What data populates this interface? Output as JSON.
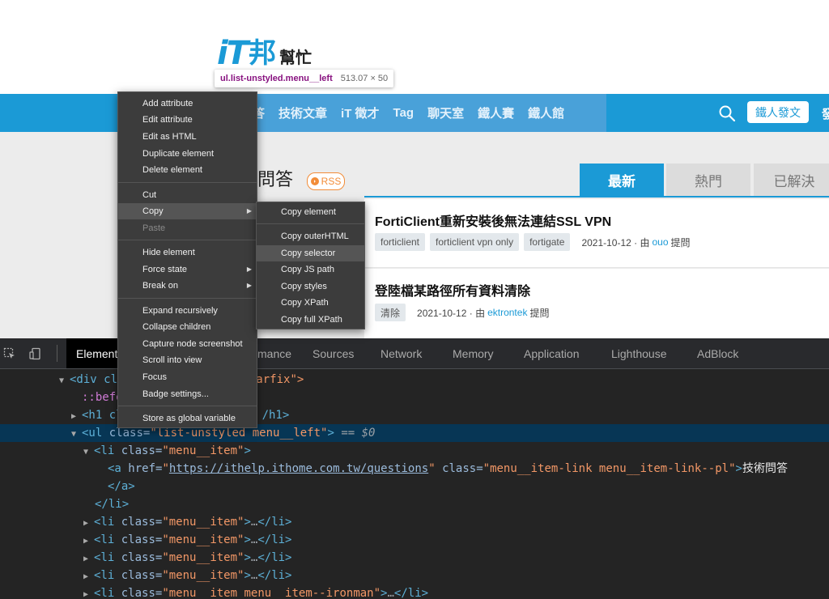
{
  "site": {
    "logo": {
      "it": "iT",
      "bang": "邦",
      "help": "幫忙"
    },
    "tooltip": {
      "selector": "ul.list-unstyled.menu__left",
      "dims": "513.07 × 50"
    },
    "nav": [
      "答",
      "技術文章",
      "iT 徵才",
      "Tag",
      "聊天室",
      "鐵人賽",
      "鐵人館"
    ],
    "ask_button": "鐵人發文",
    "nav_trail": "發",
    "section_title": "新問答",
    "rss": "RSS",
    "tabs": [
      "最新",
      "熱門",
      "已解決"
    ],
    "questions": [
      {
        "title": "FortiClient重新安裝後無法連結SSL VPN",
        "tags": [
          "forticlient",
          "forticlient vpn only",
          "fortigate"
        ],
        "date": "2021-10-12 · 由",
        "user": "ouo",
        "action": "提問"
      },
      {
        "title": "登陸檔某路徑所有資料清除",
        "tags": [
          "清除"
        ],
        "date": "2021-10-12 · 由",
        "user": "ektrontek",
        "action": "提問"
      }
    ]
  },
  "devtools": {
    "tabs": [
      "Elements",
      "mance",
      "Sources",
      "Network",
      "Memory",
      "Application",
      "Lighthouse",
      "AdBlock"
    ],
    "code": {
      "l1_open": "<div cl",
      "l1_rest": "clearfix\">",
      "l2_pseudo": "::befo",
      "l3_open": "<h1 cl",
      "l3_rest": "/h1>",
      "l4_tag": "<ul",
      "l4_attr": "class=",
      "l4_val": "\"list-unstyled menu__left\"",
      "l4_close": ">",
      "l4_eq": "== $0",
      "l5_tag": "<li",
      "l5_attr": "class=",
      "l5_val": "\"menu__item\"",
      "l5_close": ">",
      "l6_tag": "<a",
      "l6_href_attr": "href=",
      "l6_href_q1": "\"",
      "l6_href": "https://ithelp.ithome.com.tw/questions",
      "l6_href_q2": "\"",
      "l6_class_attr": "class=",
      "l6_class_val": "\"menu__item-link  menu__item-link--pl\"",
      "l6_close": ">",
      "l6_text": "技術問答",
      "l7": "</a>",
      "l8": "</li>",
      "li_tag": "<li",
      "li_attr": "class=",
      "li_val": "\"menu__item\"",
      "li_close": ">",
      "li_dots": "…",
      "li_end": "</li>",
      "last_val": "\"menu__item menu__item--ironman\""
    }
  },
  "context_menu": {
    "items": [
      "Add attribute",
      "Edit attribute",
      "Edit as HTML",
      "Duplicate element",
      "Delete element",
      "Cut",
      "Copy",
      "Paste",
      "Hide element",
      "Force state",
      "Break on",
      "Expand recursively",
      "Collapse children",
      "Capture node screenshot",
      "Scroll into view",
      "Focus",
      "Badge settings...",
      "Store as global variable"
    ],
    "submenu": [
      "Copy element",
      "Copy outerHTML",
      "Copy selector",
      "Copy JS path",
      "Copy styles",
      "Copy XPath",
      "Copy full XPath"
    ]
  }
}
